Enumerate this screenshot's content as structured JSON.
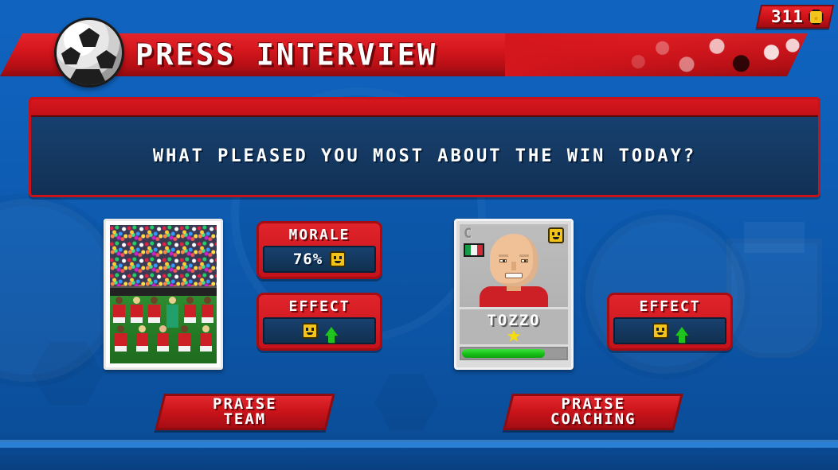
{
  "header": {
    "title": "PRESS INTERVIEW",
    "ball_icon": "football-icon"
  },
  "currency": {
    "amount": "311",
    "icon": "coin-icon"
  },
  "question": {
    "text": "WHAT PLEASED YOU MOST ABOUT THE WIN TODAY?"
  },
  "team_option": {
    "photo_alt": "team-squad-photo",
    "morale": {
      "label": "MORALE",
      "value": "76%",
      "mood_icon": "smiley-face-icon"
    },
    "effect": {
      "label": "EFFECT",
      "mood_icon": "smiley-face-icon",
      "trend_icon": "arrow-up-icon"
    },
    "button_line1": "PRAISE",
    "button_line2": "TEAM"
  },
  "coach_option": {
    "card": {
      "position": "C",
      "nationality_icon": "italy-flag-icon",
      "mood_icon": "smiley-face-icon",
      "name": "TOZZO",
      "star_icon": "star-icon",
      "rating_percent": 80
    },
    "effect": {
      "label": "EFFECT",
      "mood_icon": "smiley-face-icon",
      "trend_icon": "arrow-up-icon"
    },
    "button_line1": "PRAISE",
    "button_line2": "COACHING"
  },
  "colors": {
    "background_blue": "#0f62c0",
    "panel_red": "#c6121a",
    "panel_dark_blue": "#17406f",
    "accent_yellow": "#f2c41c",
    "accent_green": "#1fc41f"
  }
}
